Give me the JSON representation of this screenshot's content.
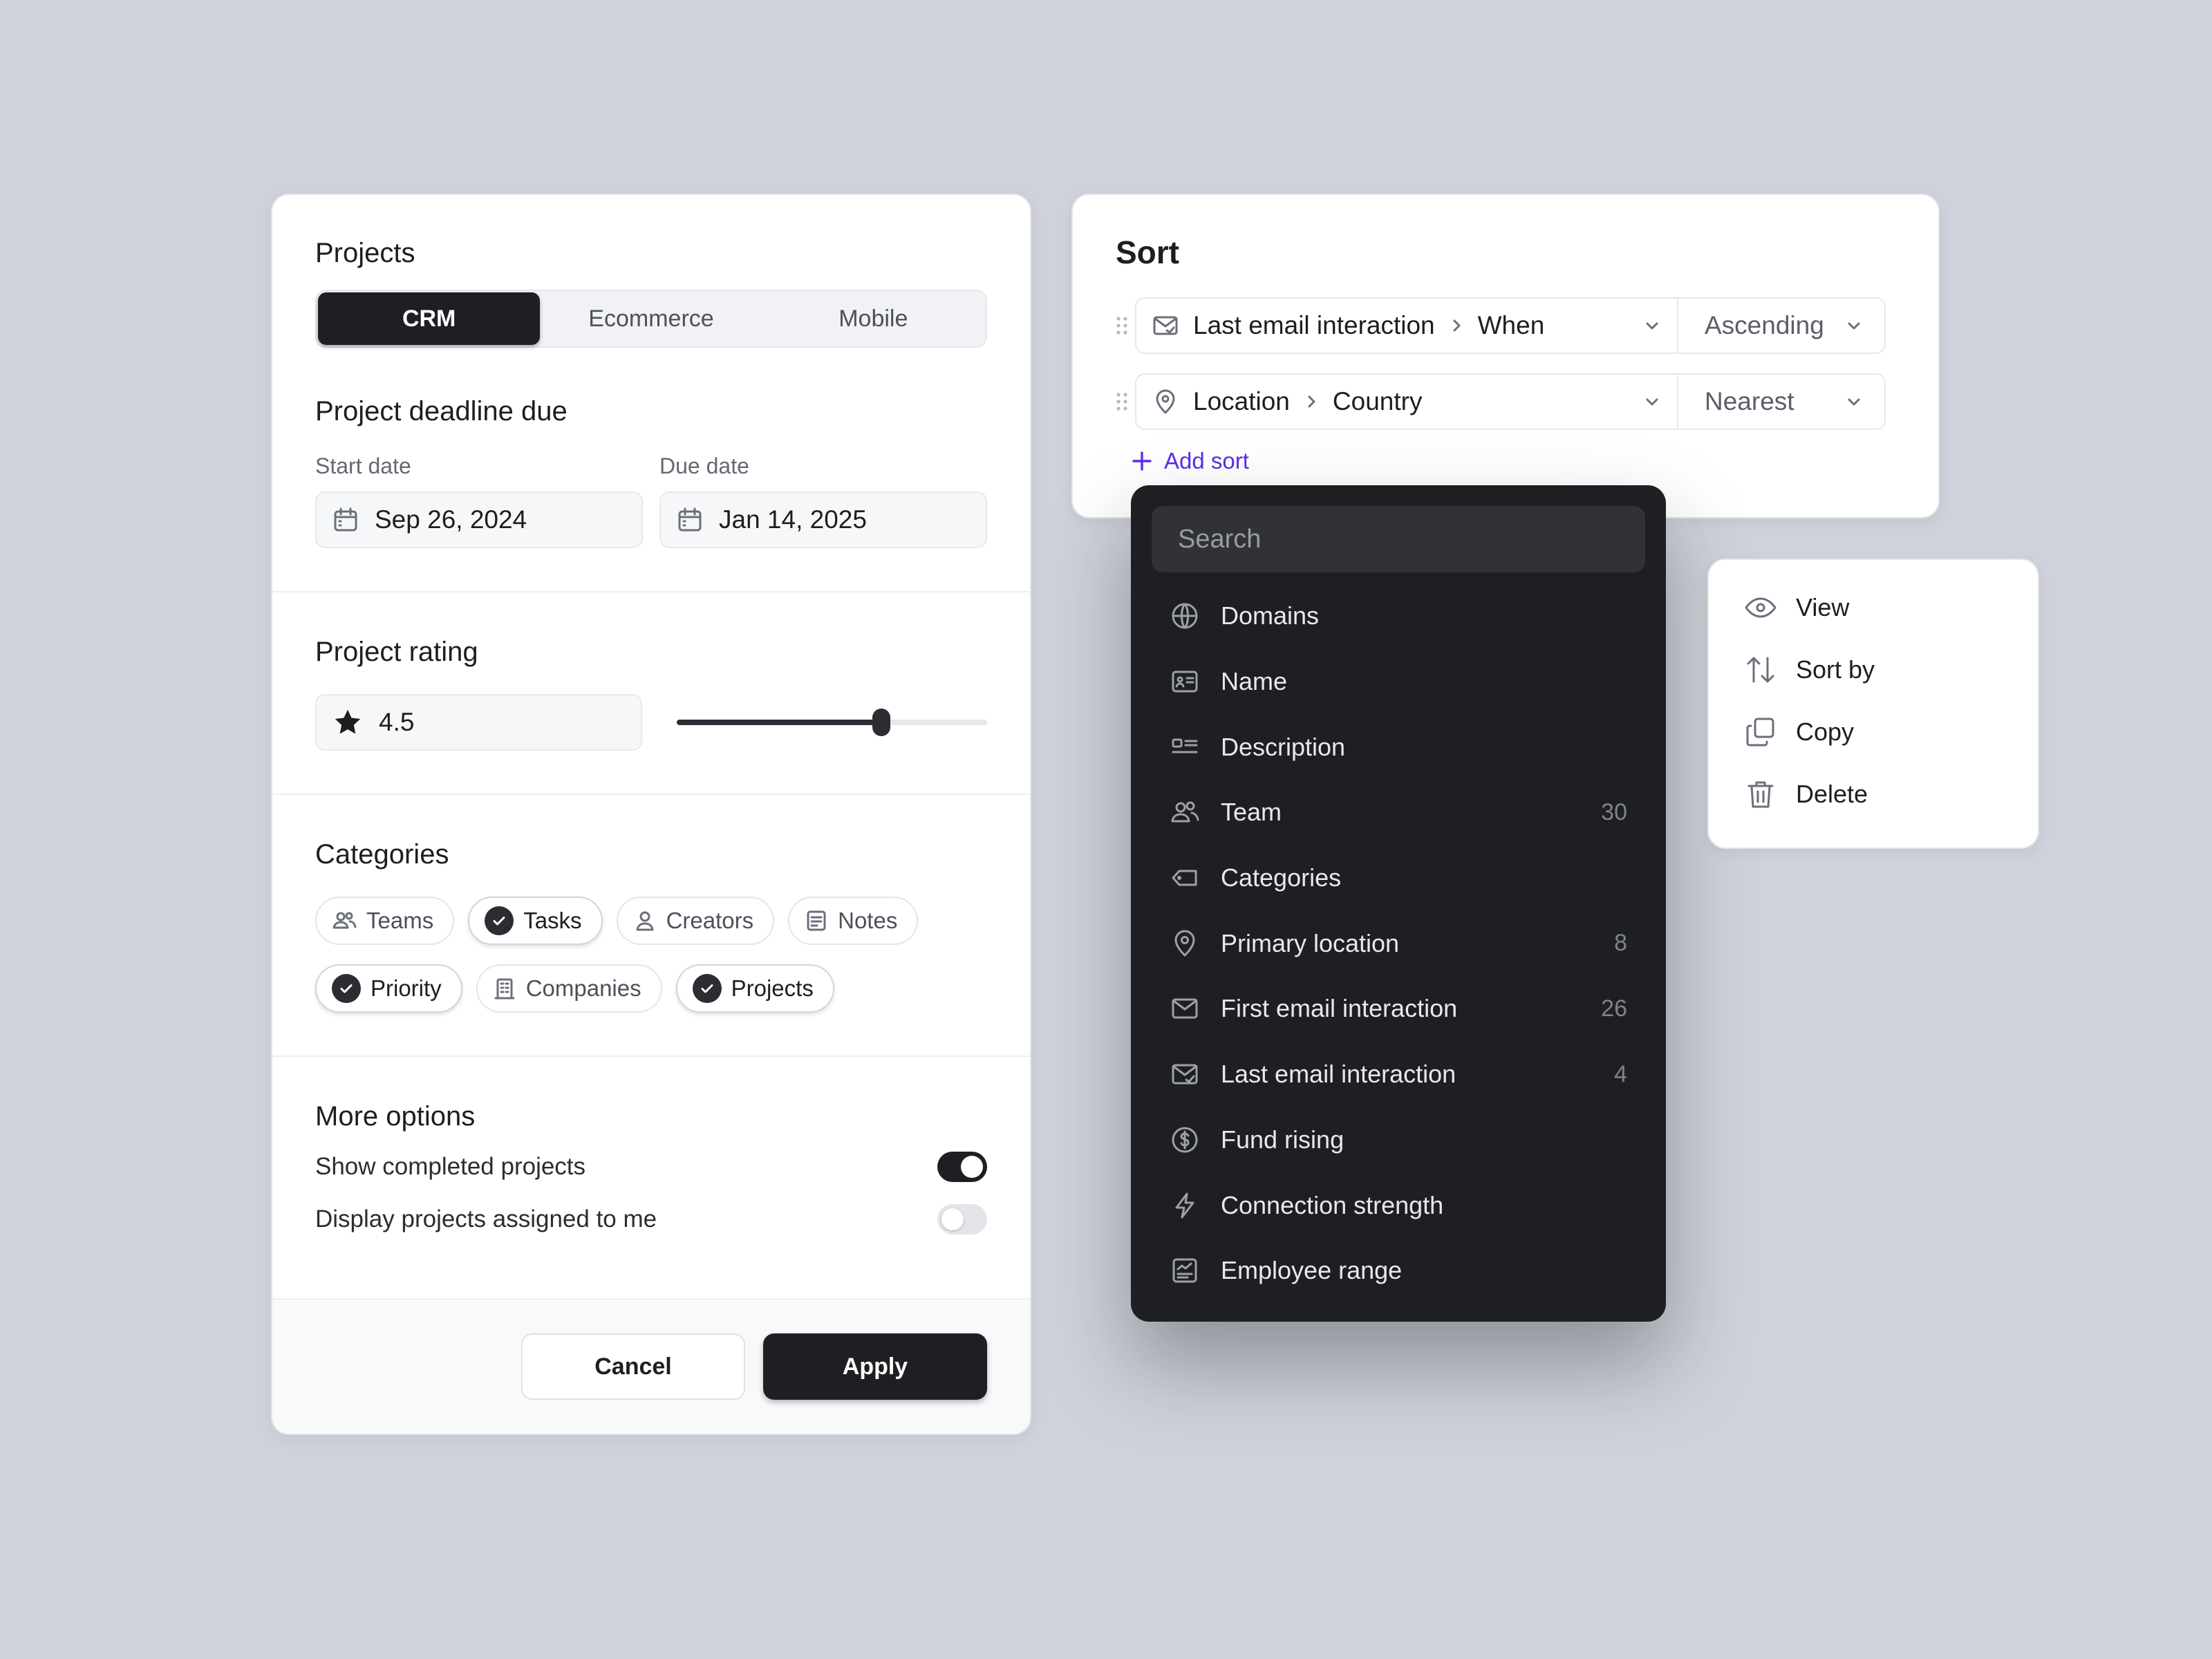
{
  "projects": {
    "title": "Projects",
    "tabs": [
      {
        "label": "CRM",
        "active": true
      },
      {
        "label": "Ecommerce",
        "active": false
      },
      {
        "label": "Mobile",
        "active": false
      }
    ]
  },
  "deadline": {
    "title": "Project deadline due",
    "start_label": "Start date",
    "start_value": "Sep 26, 2024",
    "due_label": "Due date",
    "due_value": "Jan 14, 2025"
  },
  "rating": {
    "title": "Project rating",
    "value": "4.5",
    "slider_fraction": 0.66
  },
  "categories": {
    "title": "Categories",
    "chips": [
      {
        "label": "Teams",
        "checked": false,
        "icon": "users-icon"
      },
      {
        "label": "Tasks",
        "checked": true,
        "icon": "check-icon"
      },
      {
        "label": "Creators",
        "checked": false,
        "icon": "user-icon"
      },
      {
        "label": "Notes",
        "checked": false,
        "icon": "note-icon"
      },
      {
        "label": "Priority",
        "checked": true,
        "icon": "check-icon"
      },
      {
        "label": "Companies",
        "checked": false,
        "icon": "building-icon"
      },
      {
        "label": "Projects",
        "checked": true,
        "icon": "check-icon"
      }
    ]
  },
  "options": {
    "title": "More options",
    "toggles": [
      {
        "label": "Show completed projects",
        "on": true
      },
      {
        "label": "Display projects assigned to me",
        "on": false
      }
    ]
  },
  "footer": {
    "cancel": "Cancel",
    "apply": "Apply"
  },
  "sort": {
    "title": "Sort",
    "rows": [
      {
        "field": "Last email interaction",
        "sub": "When",
        "direction": "Ascending",
        "icon": "mail-check-icon"
      },
      {
        "field": "Location",
        "sub": "Country",
        "direction": "Nearest",
        "icon": "pin-icon"
      }
    ],
    "add_label": "Add sort"
  },
  "dropdown": {
    "placeholder": "Search",
    "items": [
      {
        "label": "Domains",
        "count": "",
        "icon": "globe-icon"
      },
      {
        "label": "Name",
        "count": "",
        "icon": "id-card-icon"
      },
      {
        "label": "Description",
        "count": "",
        "icon": "description-icon"
      },
      {
        "label": "Team",
        "count": "30",
        "icon": "users-icon"
      },
      {
        "label": "Categories",
        "count": "",
        "icon": "tag-icon"
      },
      {
        "label": "Primary location",
        "count": "8",
        "icon": "pin-icon"
      },
      {
        "label": "First email interaction",
        "count": "26",
        "icon": "mail-icon"
      },
      {
        "label": "Last email interaction",
        "count": "4",
        "icon": "mail-check-icon"
      },
      {
        "label": "Fund rising",
        "count": "",
        "icon": "dollar-icon"
      },
      {
        "label": "Connection strength",
        "count": "",
        "icon": "bolt-icon"
      },
      {
        "label": "Employee range",
        "count": "",
        "icon": "chart-icon"
      }
    ]
  },
  "context_menu": {
    "items": [
      {
        "label": "View",
        "icon": "eye-icon"
      },
      {
        "label": "Sort by",
        "icon": "sort-icon"
      },
      {
        "label": "Copy",
        "icon": "copy-icon"
      },
      {
        "label": "Delete",
        "icon": "trash-icon"
      }
    ]
  },
  "colors": {
    "accent": "#5b2ee6",
    "dark": "#1e1f22",
    "background": "#cfd2da"
  }
}
